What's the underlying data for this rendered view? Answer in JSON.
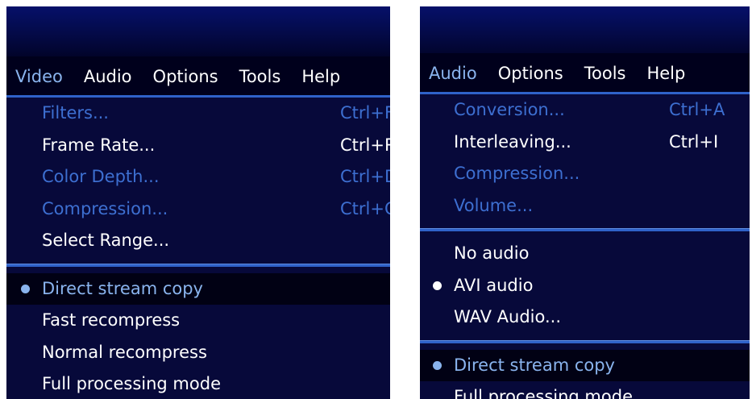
{
  "left_panel": {
    "menubar": [
      "Video",
      "Audio",
      "Options",
      "Tools",
      "Help"
    ],
    "active_menu": "Video",
    "menu_items": [
      {
        "label": "Filters...",
        "shortcut": "Ctrl+F",
        "disabled": true
      },
      {
        "label": "Frame Rate...",
        "shortcut": "Ctrl+R",
        "disabled": false
      },
      {
        "label": "Color Depth...",
        "shortcut": "Ctrl+D",
        "disabled": true
      },
      {
        "label": "Compression...",
        "shortcut": "Ctrl+C",
        "disabled": true
      },
      {
        "label": "Select Range...",
        "shortcut": "",
        "disabled": false
      },
      {
        "label": "Direct stream copy",
        "selected": true,
        "highlighted": true
      },
      {
        "label": "Fast recompress"
      },
      {
        "label": "Normal recompress"
      },
      {
        "label": "Full processing mode"
      }
    ]
  },
  "right_panel": {
    "menubar": [
      "Audio",
      "Options",
      "Tools",
      "Help"
    ],
    "active_menu": "Audio",
    "menu_items": [
      {
        "label": "Conversion...",
        "shortcut": "Ctrl+A",
        "disabled": true
      },
      {
        "label": "Interleaving...",
        "shortcut": "Ctrl+I",
        "disabled": false
      },
      {
        "label": "Compression...",
        "shortcut": "",
        "disabled": true
      },
      {
        "label": "Volume...",
        "shortcut": "",
        "disabled": true
      },
      {
        "label": "No audio"
      },
      {
        "label": "AVI audio",
        "selected": true
      },
      {
        "label": "WAV Audio..."
      },
      {
        "label": "Direct stream copy",
        "selected": true,
        "highlighted": true
      },
      {
        "label": "Full processing mode"
      }
    ]
  },
  "colors": {
    "menu_background": "#07093a",
    "disabled_text": "#3d6fd1",
    "separator": "#2f62c9",
    "highlight_background": "#010114",
    "active_menubar_text": "#8ab4ee"
  }
}
